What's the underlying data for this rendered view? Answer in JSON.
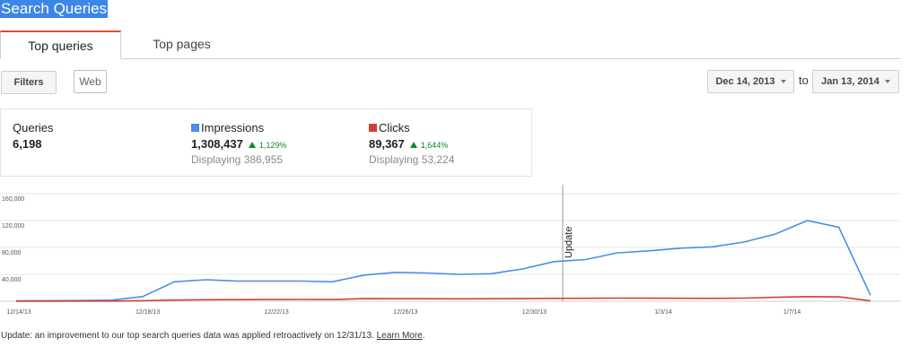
{
  "page_title": "Search Queries",
  "tabs": [
    {
      "label": "Top queries",
      "active": true
    },
    {
      "label": "Top pages",
      "active": false
    }
  ],
  "filters_button": "Filters",
  "web_button": "Web",
  "date_range": {
    "from": "Dec 14, 2013",
    "separator": "to",
    "to": "Jan 13, 2014"
  },
  "stats": {
    "queries": {
      "label": "Queries",
      "value": "6,198"
    },
    "impressions": {
      "label": "Impressions",
      "value": "1,308,437",
      "change": "1,129%",
      "displaying": "Displaying 386,955",
      "color": "#4a8ee6"
    },
    "clicks": {
      "label": "Clicks",
      "value": "89,367",
      "change": "1,644%",
      "displaying": "Displaying 53,224",
      "color": "#d0402f"
    }
  },
  "chart_data": {
    "type": "line",
    "y_ticks": [
      "160,000",
      "120,000",
      "80,000",
      "40,000"
    ],
    "ylim": [
      0,
      160000
    ],
    "x": [
      "12/14/13",
      "12/15/13",
      "12/16/13",
      "12/17/13",
      "12/18/13",
      "12/19/13",
      "12/20/13",
      "12/21/13",
      "12/22/13",
      "12/23/13",
      "12/24/13",
      "12/25/13",
      "12/26/13",
      "12/27/13",
      "12/28/13",
      "12/29/13",
      "12/30/13",
      "12/31/13",
      "1/1/14",
      "1/2/14",
      "1/3/14",
      "1/4/14",
      "1/5/14",
      "1/6/14",
      "1/7/14",
      "1/8/14",
      "1/9/14",
      "1/10/14",
      "1/11/14",
      "1/12/14",
      "1/13/14"
    ],
    "x_tick_labels": [
      "12/14/13",
      "12/18/13",
      "12/22/13",
      "12/26/13",
      "12/30/13",
      "1/3/14",
      "1/7/14"
    ],
    "series": [
      {
        "name": "Impressions",
        "color": "#4a8ee6",
        "values": [
          500,
          800,
          1100,
          1600,
          7000,
          29000,
          32000,
          30000,
          30000,
          30000,
          29000,
          39000,
          43000,
          42000,
          40000,
          41000,
          48000,
          59000,
          62000,
          72000,
          75000,
          79000,
          81000,
          88000,
          100000,
          120000,
          110000,
          9000
        ]
      },
      {
        "name": "Clicks",
        "color": "#d0402f",
        "values": [
          100,
          150,
          200,
          250,
          800,
          1800,
          2300,
          2400,
          2600,
          2700,
          2600,
          3900,
          3800,
          3700,
          3600,
          3700,
          3900,
          4200,
          4400,
          4600,
          4500,
          4400,
          4300,
          4700,
          5900,
          6800,
          6500,
          600
        ]
      }
    ],
    "annotation": {
      "label": "Update",
      "date": "12/31/13"
    }
  },
  "footnote": {
    "text": "Update: an improvement to our top search queries data was applied retroactively on 12/31/13. ",
    "link": "Learn More",
    "end": "."
  }
}
